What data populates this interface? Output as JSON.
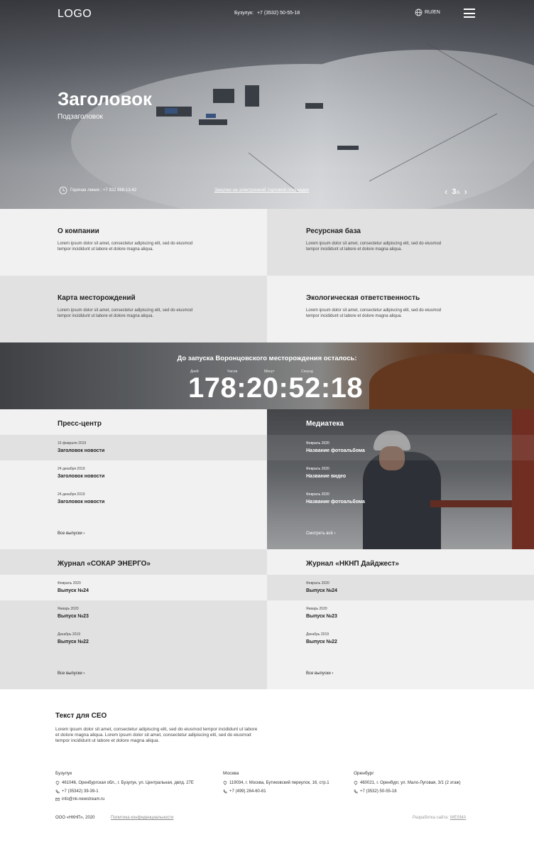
{
  "header": {
    "logo": "LOGO",
    "phone_label": "Бузулук:",
    "phone": "+7 (3532) 50-55-18",
    "lang": "RU/EN"
  },
  "hero": {
    "title": "Заголовок",
    "subtitle": "Подзаголовок",
    "hotline": "Горячая линия : +7 922 888-13-62",
    "tender_link": "Закупки на электронной торговой площадке",
    "slide_current": "3",
    "slide_total": "/5"
  },
  "tiles": [
    {
      "title": "О компании",
      "text": "Lorem ipsum dolor sit amet, consectetur adipiscing elit, sed do eiusmod tempor incididunt ut labore et dolore magna aliqua."
    },
    {
      "title": "Ресурсная база",
      "text": "Lorem ipsum dolor sit amet, consectetur adipiscing elit, sed do eiusmod tempor incididunt ut labore et dolore magna aliqua."
    },
    {
      "title": "Карта месторождений",
      "text": "Lorem ipsum dolor sit amet, consectetur adipiscing elit, sed do eiusmod tempor incididunt ut labore et dolore magna aliqua."
    },
    {
      "title": "Экологическая ответственность",
      "text": "Lorem ipsum dolor sit amet, consectetur adipiscing elit, sed do eiusmod tempor incididunt ut labore et dolore magna aliqua."
    }
  ],
  "countdown": {
    "title": "До запуска Воронцовского месторождения осталось:",
    "labels": [
      "Дней",
      "Часов",
      "Минут",
      "Секунд"
    ],
    "value": "178:20:52:18"
  },
  "press": {
    "title": "Пресс-центр",
    "items": [
      {
        "date": "15 февраля 2019",
        "title": "Заголовок новости"
      },
      {
        "date": "24 декабря 2019",
        "title": "Заголовок новости"
      },
      {
        "date": "24 декабря 2019",
        "title": "Заголовок новости"
      }
    ],
    "more": "Все выпуски"
  },
  "media": {
    "title": "Медиатека",
    "items": [
      {
        "date": "Февраль 2020",
        "title": "Название фотоальбома"
      },
      {
        "date": "Февраль 2020",
        "title": "Название видео"
      },
      {
        "date": "Февраль 2020",
        "title": "Название фотоальбома"
      }
    ],
    "more": "Смотреть всё"
  },
  "journal_left": {
    "title": "Журнал «СОКАР ЭНЕРГО»",
    "items": [
      {
        "date": "Февраль 2020",
        "title": "Выпуск №24"
      },
      {
        "date": "Январь 2020",
        "title": "Выпуск №23"
      },
      {
        "date": "Декабрь 2019",
        "title": "Выпуск №22"
      }
    ],
    "more": "Все выпуски"
  },
  "journal_right": {
    "title": "Журнал «НКНП Дайджест»",
    "items": [
      {
        "date": "Февраль 2020",
        "title": "Выпуск №24"
      },
      {
        "date": "Январь 2020",
        "title": "Выпуск №23"
      },
      {
        "date": "Декабрь 2019",
        "title": "Выпуск №22"
      }
    ],
    "more": "Все выпуски"
  },
  "seo": {
    "title": "Текст для СЕО",
    "text": "Lorem ipsum dolor sit amet, consectetur adipiscing elit, sed do eiusmod tempor incididunt ut labore et dolore magna aliqua. Lorem ipsum dolor sit amet, consectetur adipiscing elit, sed do eiusmod tempor incididunt ut labore et dolore magna aliqua."
  },
  "offices": [
    {
      "city": "Бузулук",
      "address": "461046, Оренбургская обл., г. Бузулук, ул. Центральная, двлд. 27Е",
      "phone": "+7 (35342) 39-39-1",
      "email": "info@nk-newstream.ru"
    },
    {
      "city": "Москва",
      "address": "119034, г. Москва, Бутиковский переулок, 16, стр.1",
      "phone": "+7 (499) 284-60-81"
    },
    {
      "city": "Оренбург",
      "address": "460021, г. Оренбург, ул. Мало-Луговая, 3/1 (2 этаж)",
      "phone": "+7 (3532) 50-55-18"
    }
  ],
  "footer": {
    "copyright": "ООО «НКНП», 2020",
    "policy": "Политика конфиденциальности",
    "dev_label": "Разработка сайта:",
    "dev_name": "WESMA"
  }
}
